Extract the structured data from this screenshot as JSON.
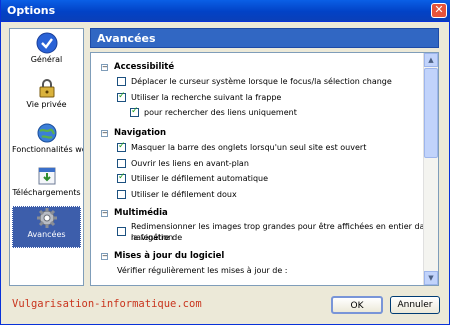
{
  "window": {
    "title": "Options",
    "close_symbol": "✕"
  },
  "sidebar": {
    "items": [
      {
        "label": "Général",
        "icon": "check-circle-icon",
        "selected": false
      },
      {
        "label": "Vie privée",
        "icon": "privacy-icon",
        "selected": false
      },
      {
        "label": "Fonctionnalités web",
        "icon": "globe-icon",
        "selected": false
      },
      {
        "label": "Téléchargements",
        "icon": "downloads-icon",
        "selected": false
      },
      {
        "label": "Avancées",
        "icon": "gear-icon",
        "selected": true
      }
    ]
  },
  "panel": {
    "title": "Avancées"
  },
  "sections": {
    "accessibilite": {
      "title": "Accessibilité",
      "options": [
        {
          "label": "Déplacer le curseur système lorsque le focus/la sélection change",
          "checked": false
        },
        {
          "label": "Utiliser la recherche suivant la frappe",
          "checked": true
        },
        {
          "label": "pour rechercher des liens uniquement",
          "checked": true
        }
      ]
    },
    "navigation": {
      "title": "Navigation",
      "options": [
        {
          "label": "Masquer la barre des onglets lorsqu'un seul site est ouvert",
          "checked": true
        },
        {
          "label": "Ouvrir les liens en avant-plan",
          "checked": false
        },
        {
          "label": "Utiliser le défilement automatique",
          "checked": true
        },
        {
          "label": "Utiliser le défilement doux",
          "checked": false
        }
      ]
    },
    "multimedia": {
      "title": "Multimédia",
      "option_line1": "Redimensionner les images trop grandes pour être affichées en entier dans la fenêtre de",
      "option_line2": "navigation",
      "checked": false
    },
    "mises_a_jour": {
      "title": "Mises à jour du logiciel",
      "subtitle": "Vérifier régulièrement les mises à jour de :"
    }
  },
  "footer": {
    "watermark": "Vulgarisation-informatique.com",
    "ok_label": "OK",
    "cancel_label": "Annuler"
  },
  "colors": {
    "titlebar": "#0a5fe6",
    "panel_header": "#3167c3",
    "selected_item": "#3d5eab",
    "watermark": "#c9351e",
    "checkmark": "#21a121"
  }
}
